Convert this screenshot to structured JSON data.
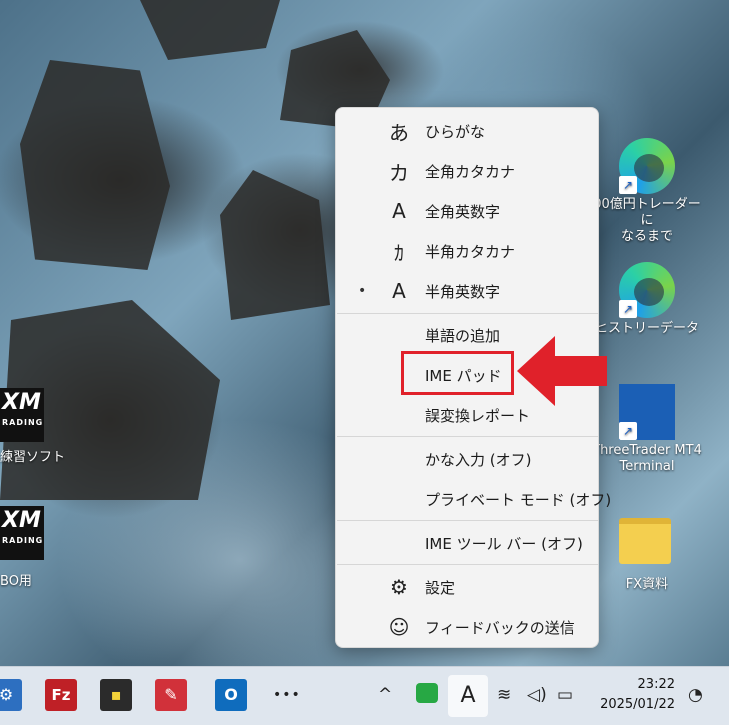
{
  "desktop_icons": [
    {
      "label_line1": "00億円トレーダーに",
      "label_line2": "なるまで",
      "icon": "edge-icon"
    },
    {
      "label_line1": "ヒストリーデータ",
      "label_line2": "",
      "icon": "edge-icon"
    },
    {
      "label_line1": "ThreeTrader MT4",
      "label_line2": "Terminal",
      "icon": "threetrader-icon"
    },
    {
      "label_line1": "FX資料",
      "label_line2": "",
      "icon": "folder-icon"
    }
  ],
  "left_icons": [
    {
      "label": "練習ソフト",
      "brand": "XM",
      "sub": "RADING"
    },
    {
      "label": "BO用",
      "brand": "XM",
      "sub": "RADING"
    }
  ],
  "menu": {
    "items": [
      {
        "icon": "あ",
        "label": "ひらがな",
        "bullet": ""
      },
      {
        "icon": "カ",
        "label": "全角カタカナ",
        "bullet": ""
      },
      {
        "icon": "A",
        "label": "全角英数字",
        "bullet": ""
      },
      {
        "icon": "ｶ",
        "label": "半角カタカナ",
        "bullet": ""
      },
      {
        "icon": "A",
        "label": "半角英数字",
        "bullet": "•"
      },
      {
        "icon": "",
        "label": "単語の追加",
        "bullet": ""
      },
      {
        "icon": "",
        "label": "IME パッド",
        "bullet": ""
      },
      {
        "icon": "",
        "label": "誤変換レポート",
        "bullet": ""
      },
      {
        "icon": "",
        "label": "かな入力 (オフ)",
        "bullet": ""
      },
      {
        "icon": "",
        "label": "プライベート モード (オフ)",
        "bullet": ""
      },
      {
        "icon": "",
        "label": "IME ツール バー (オフ)",
        "bullet": ""
      },
      {
        "icon": "⚙",
        "label": "設定",
        "bullet": ""
      },
      {
        "icon": "☺",
        "label": "フィードバックの送信",
        "bullet": ""
      }
    ]
  },
  "taskbar": {
    "apps": [
      {
        "name": "app-partial",
        "glyph": "⚙",
        "color": "#2d6fc0"
      },
      {
        "name": "filezilla",
        "glyph": "Fz",
        "color": "#bf2026"
      },
      {
        "name": "sticky-notes",
        "glyph": "▪",
        "color": "#2b2b2b"
      },
      {
        "name": "app-red",
        "glyph": "✎",
        "color": "#d1313a"
      },
      {
        "name": "outlook",
        "glyph": "O",
        "color": "#0f6cbd"
      }
    ],
    "more": "•••",
    "ime_mode": "A",
    "time": "23:22",
    "date": "2025/01/22",
    "colors": {
      "highlight": "#e0212a",
      "accent": "#0f6cbd"
    }
  }
}
